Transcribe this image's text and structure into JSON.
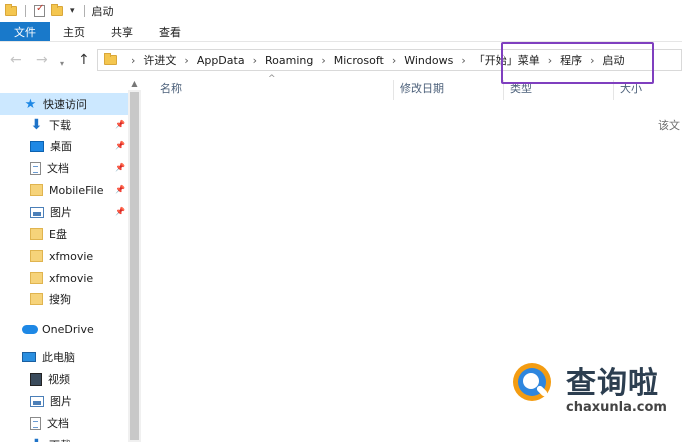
{
  "window": {
    "title": "启动"
  },
  "ribbon": {
    "tabs": [
      "文件",
      "主页",
      "共享",
      "查看"
    ]
  },
  "address": {
    "crumbs": [
      "许进文",
      "AppData",
      "Roaming",
      "Microsoft",
      "Windows",
      "「开始」菜单",
      "程序",
      "启动"
    ]
  },
  "sidebar": {
    "quick_access": "快速访问",
    "pinned": [
      {
        "label": "下载",
        "icon": "download-icon"
      },
      {
        "label": "桌面",
        "icon": "desktop-icon"
      },
      {
        "label": "文档",
        "icon": "document-icon"
      },
      {
        "label": "MobileFile",
        "icon": "folder-icon"
      },
      {
        "label": "图片",
        "icon": "pictures-icon"
      }
    ],
    "folders": [
      "E盘",
      "xfmovie",
      "xfmovie",
      "搜狗"
    ],
    "onedrive": "OneDrive",
    "this_pc": "此电脑",
    "pc_items": [
      "视频",
      "图片",
      "文档",
      "下载"
    ]
  },
  "columns": {
    "name": "名称",
    "modified": "修改日期",
    "type": "类型",
    "size": "大小"
  },
  "content": {
    "empty_message": "该文"
  },
  "watermark": {
    "name": "查询啦",
    "url": "chaxunla.com"
  },
  "colors": {
    "accent": "#1979ca",
    "selection": "#cce8ff",
    "highlight_box": "#7f3fbf"
  }
}
